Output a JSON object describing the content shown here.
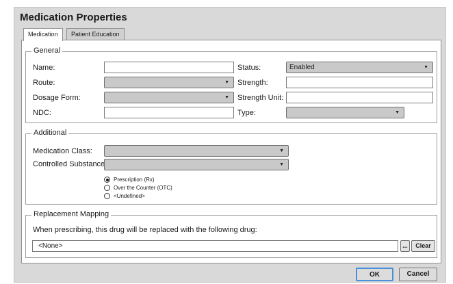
{
  "dialog": {
    "title": "Medication Properties"
  },
  "tabs": [
    {
      "label": "Medication",
      "active": true
    },
    {
      "label": "Patient Education",
      "active": false
    }
  ],
  "general": {
    "legend": "General",
    "name_label": "Name:",
    "name_value": "",
    "route_label": "Route:",
    "route_value": "",
    "dosage_label": "Dosage Form:",
    "dosage_value": "",
    "ndc_label": "NDC:",
    "ndc_value": "",
    "status_label": "Status:",
    "status_value": "Enabled",
    "strength_label": "Strength:",
    "strength_value": "",
    "strength_unit_label": "Strength Unit:",
    "strength_unit_value": "",
    "type_label": "Type:",
    "type_value": ""
  },
  "additional": {
    "legend": "Additional",
    "med_class_label": "Medication Class:",
    "med_class_value": "",
    "controlled_label": "Controlled Substance:",
    "controlled_value": "",
    "radios": [
      {
        "label": "Prescription (Rx)",
        "checked": true
      },
      {
        "label": "Over the Counter (OTC)",
        "checked": false
      },
      {
        "label": "<Undefined>",
        "checked": false
      }
    ]
  },
  "replacement": {
    "legend": "Replacement Mapping",
    "instruction": "When prescribing, this drug will be replaced with the following drug:",
    "drug_value": "<None>",
    "browse_label": "...",
    "clear_label": "Clear"
  },
  "footer": {
    "ok_label": "OK",
    "cancel_label": "Cancel"
  },
  "colors": {
    "dialog_bg": "#d9d9d9",
    "ok_border": "#4a90d9",
    "field_disabled": "#c9c9c9"
  },
  "icons": {
    "dropdown": "chevron-down-icon"
  }
}
